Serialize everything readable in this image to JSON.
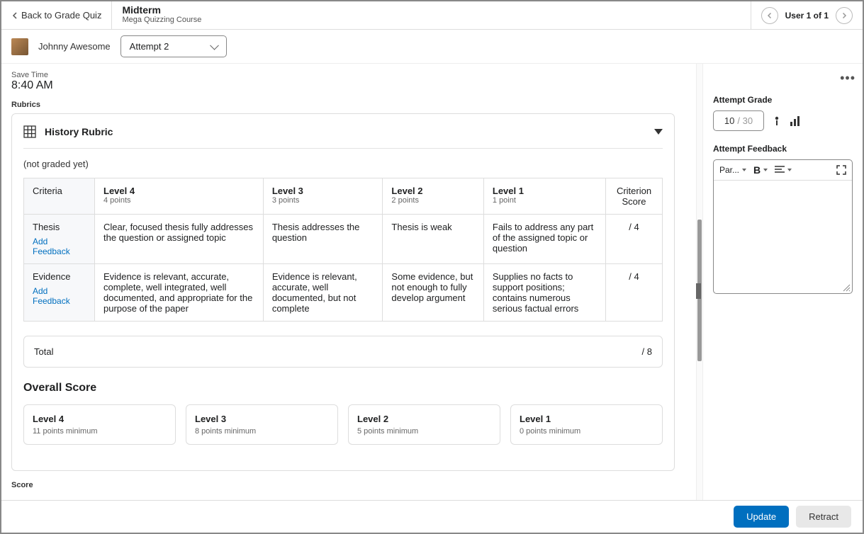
{
  "topbar": {
    "back": "Back to Grade Quiz",
    "title": "Midterm",
    "subtitle": "Mega Quizzing Course",
    "user_nav": "User 1 of 1"
  },
  "userbar": {
    "name": "Johnny Awesome",
    "attempt": "Attempt 2"
  },
  "save": {
    "label": "Save Time",
    "time": "8:40 AM"
  },
  "rubrics_label": "Rubrics",
  "rubric": {
    "title": "History Rubric",
    "not_graded": "(not graded yet)",
    "headers": {
      "criteria": "Criteria",
      "score": "Criterion Score"
    },
    "levels": [
      {
        "name": "Level 4",
        "pts": "4 points"
      },
      {
        "name": "Level 3",
        "pts": "3 points"
      },
      {
        "name": "Level 2",
        "pts": "2 points"
      },
      {
        "name": "Level 1",
        "pts": "1 point"
      }
    ],
    "rows": [
      {
        "name": "Thesis",
        "add_fb": "Add Feedback",
        "cells": [
          "Clear, focused thesis fully addresses the question or assigned topic",
          "Thesis addresses the question",
          "Thesis is weak",
          "Fails to address any part of the assigned topic or question"
        ],
        "score": "/ 4"
      },
      {
        "name": "Evidence",
        "add_fb": "Add Feedback",
        "cells": [
          "Evidence is relevant, accurate, complete, well integrated, well documented, and appropriate for the purpose of the paper",
          "Evidence is relevant, accurate, well documented, but not complete",
          "Some evidence, but not enough to fully develop argument",
          "Supplies no facts to support positions; contains numerous serious factual errors"
        ],
        "score": "/ 4"
      }
    ],
    "total_label": "Total",
    "total_score": "/ 8"
  },
  "overall": {
    "title": "Overall Score",
    "levels": [
      {
        "name": "Level 4",
        "min": "11 points minimum"
      },
      {
        "name": "Level 3",
        "min": "8 points minimum"
      },
      {
        "name": "Level 2",
        "min": "5 points minimum"
      },
      {
        "name": "Level 1",
        "min": "0 points minimum"
      }
    ]
  },
  "score_label": "Score",
  "right": {
    "attempt_grade": "Attempt Grade",
    "grade_value": "10",
    "grade_max": "/ 30",
    "feedback_label": "Attempt Feedback",
    "para": "Par..."
  },
  "footer": {
    "update": "Update",
    "retract": "Retract"
  }
}
